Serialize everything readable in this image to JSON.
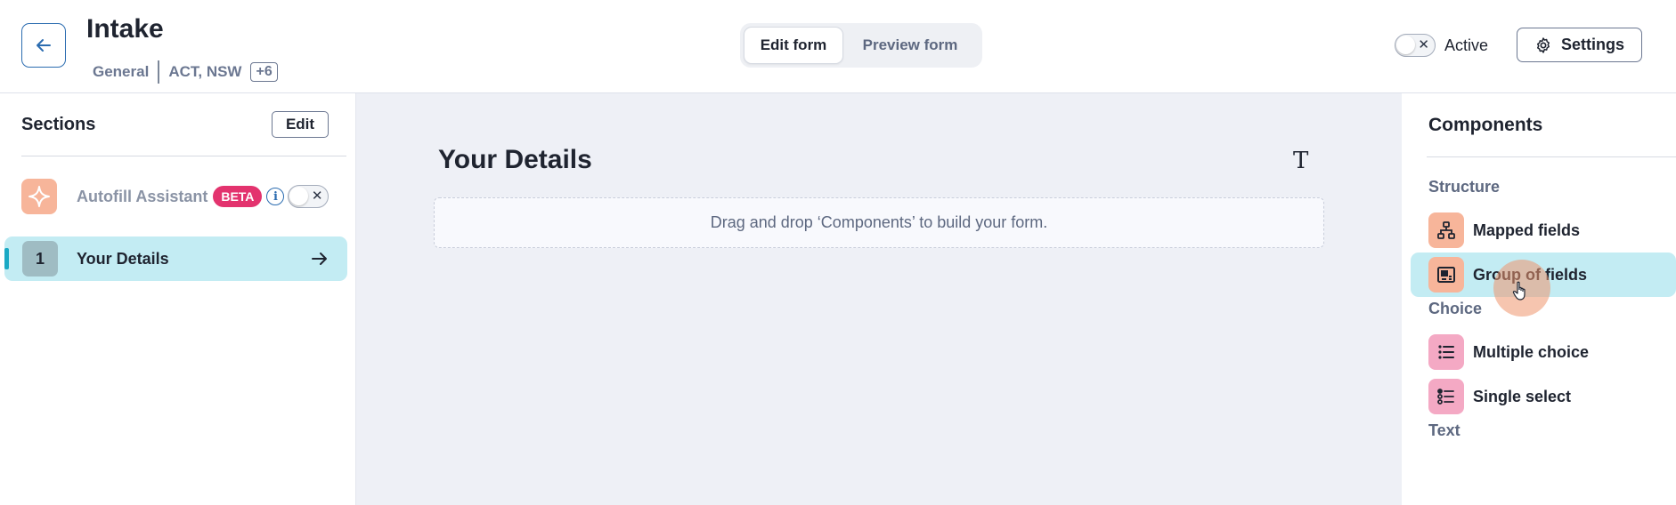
{
  "header": {
    "title": "Intake",
    "category": "General",
    "regions": "ACT, NSW",
    "regions_more": "+6",
    "mode_tabs": [
      {
        "label": "Edit form",
        "active": true
      },
      {
        "label": "Preview form",
        "active": false
      }
    ],
    "active_label": "Active",
    "settings_label": "Settings"
  },
  "sections_panel": {
    "title": "Sections",
    "edit_label": "Edit",
    "autofill": {
      "label": "Autofill Assistant",
      "badge": "BETA",
      "icon": "sparkle-icon"
    },
    "items": [
      {
        "number": "1",
        "label": "Your Details",
        "selected": true
      }
    ]
  },
  "canvas": {
    "form_title": "Your Details",
    "text_tool_glyph": "T",
    "dropzone_text": "Drag and drop ‘Components’ to build your form."
  },
  "components_panel": {
    "title": "Components",
    "groups": [
      {
        "label": "Structure",
        "items": [
          {
            "label": "Mapped fields",
            "icon": "sitemap-icon",
            "hovered": false
          },
          {
            "label": "Group of fields",
            "icon": "group-fields-icon",
            "hovered": true
          }
        ]
      },
      {
        "label": "Choice",
        "items": [
          {
            "label": "Multiple choice",
            "icon": "list-icon",
            "hovered": false
          },
          {
            "label": "Single select",
            "icon": "radio-list-icon",
            "hovered": false
          }
        ]
      },
      {
        "label": "Text",
        "items": []
      }
    ]
  },
  "colors": {
    "accent_blue": "#2b6cb0",
    "selected_bg": "#c3ecf3",
    "beta_pink": "#e3336e",
    "orange_icon_bg": "#f7b59a",
    "pink_icon_bg": "#f4a9c4",
    "canvas_bg": "#eef0f6"
  }
}
